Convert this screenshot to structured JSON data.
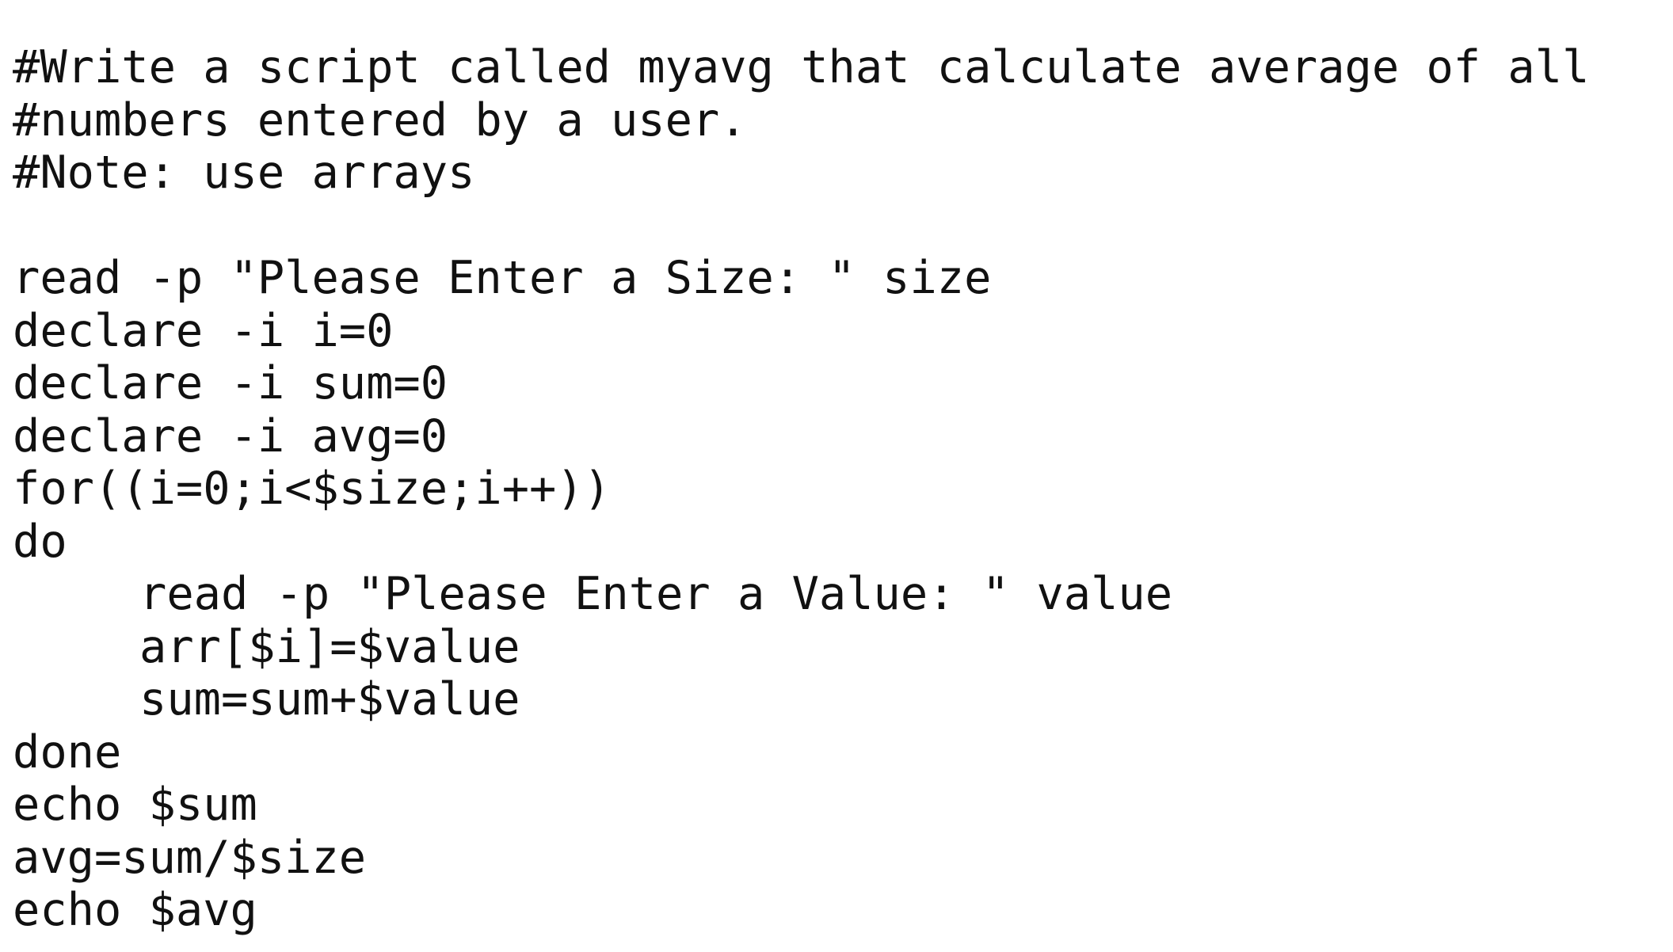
{
  "code_lines": [
    "#Write a script called myavg that calculate average of all",
    "#numbers entered by a user.",
    "#Note: use arrays",
    "",
    "read -p \"Please Enter a Size: \" size",
    "declare -i i=0",
    "declare -i sum=0",
    "declare -i avg=0",
    "for((i=0;i<$size;i++))",
    "do",
    "read -p \"Please Enter a Value: \" value",
    "arr[$i]=$value",
    "sum=sum+$value",
    "done",
    "echo $sum",
    "avg=sum/$size",
    "echo $avg"
  ]
}
